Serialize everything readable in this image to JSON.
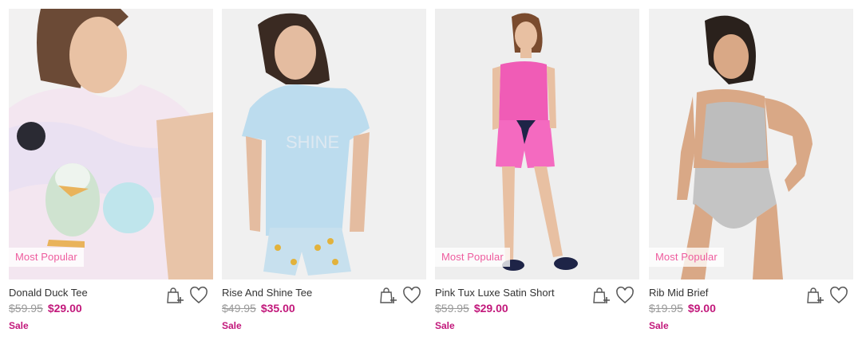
{
  "colors": {
    "sale": "#c2187b",
    "badge_text": "#ee5c9e",
    "was_price": "#999999",
    "name_text": "#333333"
  },
  "products": [
    {
      "name": "Donald Duck Tee",
      "was_price": "$59.95",
      "price": "$29.00",
      "badge": "Most Popular",
      "sale_label": "Sale",
      "add_icon": "bag-plus-icon",
      "wishlist_icon": "heart-icon"
    },
    {
      "name": "Rise And Shine Tee",
      "was_price": "$49.95",
      "price": "$35.00",
      "badge": "",
      "sale_label": "Sale",
      "add_icon": "bag-plus-icon",
      "wishlist_icon": "heart-icon"
    },
    {
      "name": "Pink Tux Luxe Satin Short",
      "was_price": "$59.95",
      "price": "$29.00",
      "badge": "Most Popular",
      "sale_label": "Sale",
      "add_icon": "bag-plus-icon",
      "wishlist_icon": "heart-icon"
    },
    {
      "name": "Rib Mid Brief",
      "was_price": "$19.95",
      "price": "$9.00",
      "badge": "Most Popular",
      "sale_label": "Sale",
      "add_icon": "bag-plus-icon",
      "wishlist_icon": "heart-icon"
    }
  ]
}
